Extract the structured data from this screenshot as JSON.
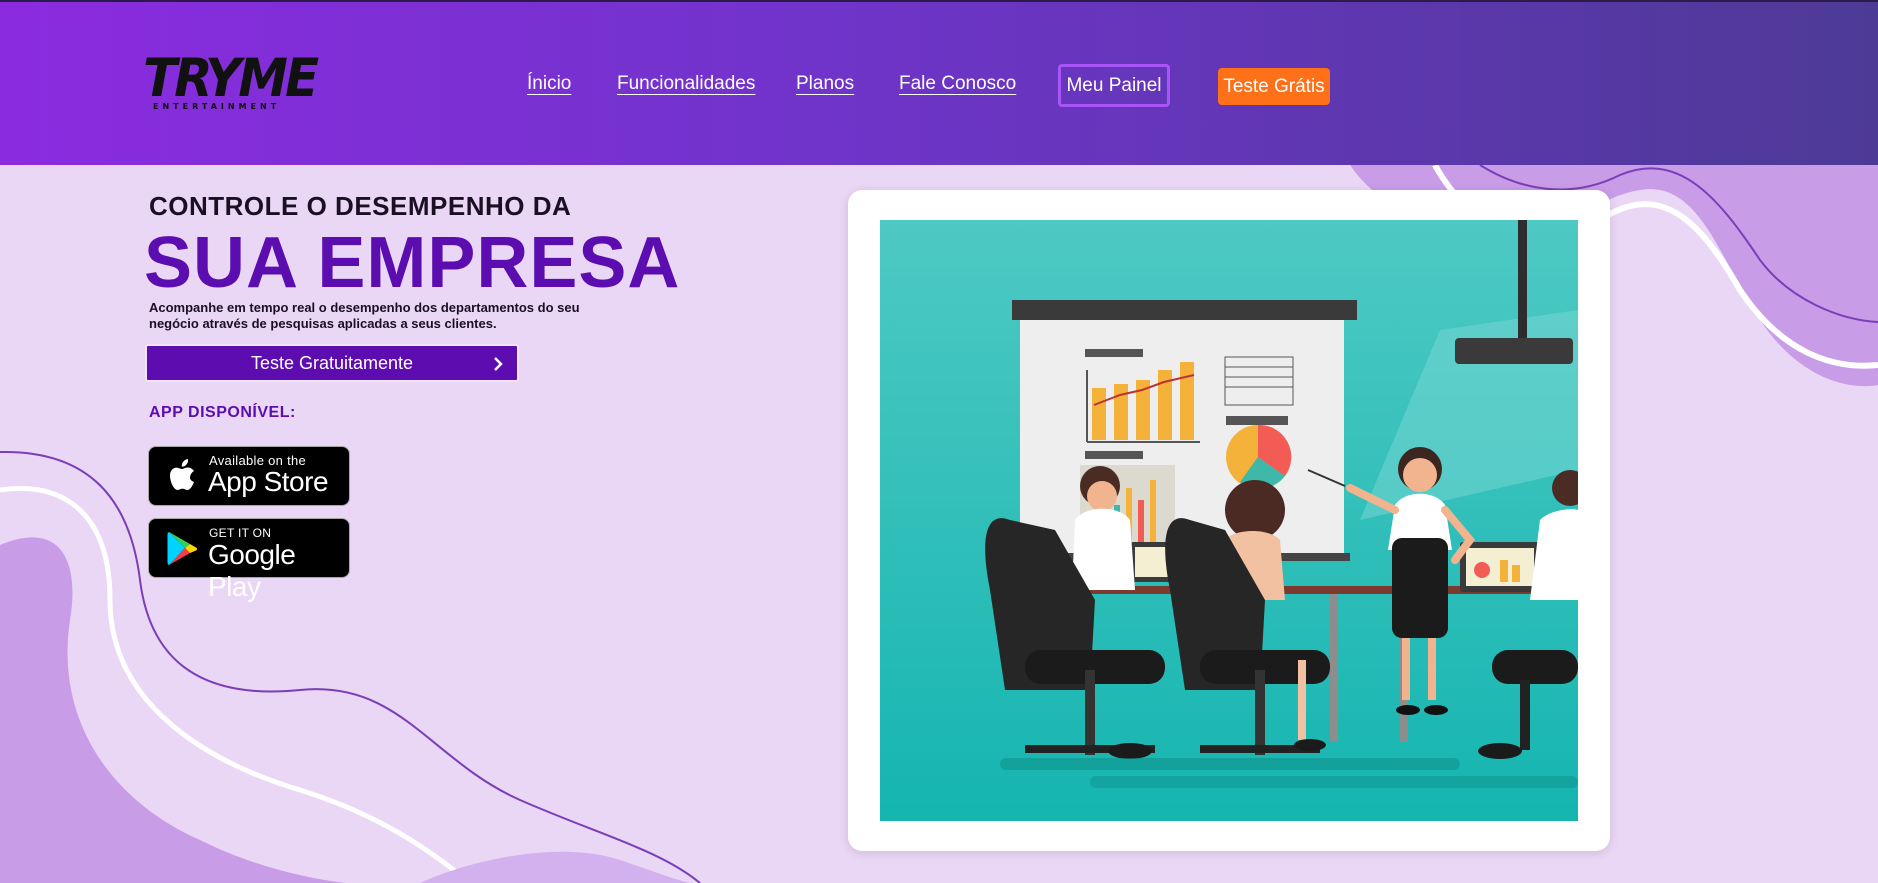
{
  "header": {
    "logo": {
      "main": "TRYME",
      "sub": "ENTERTAINMENT"
    },
    "nav": [
      {
        "label": "Ínicio"
      },
      {
        "label": "Funcionalidades"
      },
      {
        "label": "Planos"
      },
      {
        "label": "Fale Conosco"
      }
    ],
    "panel_button": "Meu Painel",
    "trial_button": "Teste Grátis"
  },
  "hero": {
    "kicker": "CONTROLE O DESEMPENHO DA",
    "title": "SUA EMPRESA",
    "description": "Acompanhe em tempo real o desempenho dos departamentos do seu negócio através de pesquisas aplicadas a seus clientes.",
    "cta_label": "Teste Gratuitamente",
    "app_label": "APP DISPONÍVEL:"
  },
  "badges": {
    "appstore": {
      "small": "Available on the",
      "big": "App Store",
      "icon": "apple-icon"
    },
    "googleplay": {
      "small": "GET IT ON",
      "big": "Google Play",
      "icon": "play-store-icon"
    }
  },
  "colors": {
    "header_start": "#8b2be0",
    "header_end": "#4d3a96",
    "background": "#ead6f5",
    "title_purple": "#5b0db0",
    "cta_purple": "#5c0caf",
    "trial_orange": "#ff7118",
    "panel_border": "#a855f7",
    "illustration_teal": "#35c1bd"
  }
}
